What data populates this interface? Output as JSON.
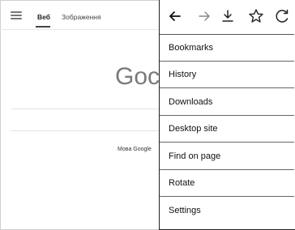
{
  "header": {
    "tabs": [
      {
        "label": "Веб"
      },
      {
        "label": "Зображення"
      }
    ]
  },
  "main": {
    "logo": "Goc",
    "language_text": "Мова Google"
  },
  "menu": {
    "toolbar": {
      "back_icon": "arrow-left",
      "forward_icon": "arrow-right",
      "download_icon": "download",
      "bookmark_icon": "star-outline",
      "reload_icon": "reload"
    },
    "items": [
      {
        "label": "Bookmarks"
      },
      {
        "label": "History"
      },
      {
        "label": "Downloads"
      },
      {
        "label": "Desktop site"
      },
      {
        "label": "Find on page"
      },
      {
        "label": "Rotate"
      },
      {
        "label": "Settings"
      }
    ]
  },
  "colors": {
    "text": "#111111",
    "muted": "#7a7a7a",
    "border": "#222222"
  }
}
